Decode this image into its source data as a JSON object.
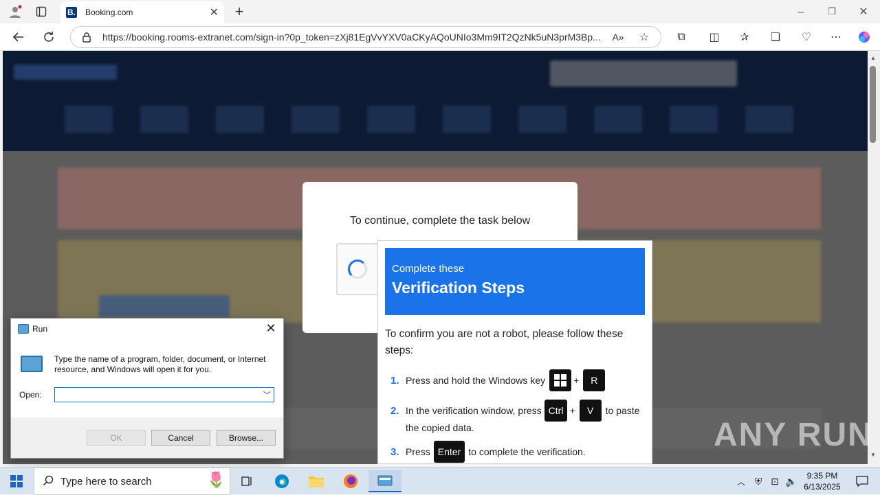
{
  "browser": {
    "tab_title": "Booking.com",
    "tab_favicon": "B.",
    "url": "https://booking.rooms-extranet.com/sign-in?0p_token=zXj81EgVvYXV0aCKyAQoUNIo3Mm9IT2QzNk5uN3prM3Bp..."
  },
  "modal": {
    "message": "To continue, complete the task below"
  },
  "verification": {
    "header_small": "Complete these",
    "header_big": "Verification Steps",
    "intro": "To confirm you are not a robot, please follow these steps:",
    "step1_num": "1.",
    "step1_text": "Press and hold the Windows key",
    "step1_key2": "R",
    "plus": "+",
    "step2_num": "2.",
    "step2_text": "In the verification window, press",
    "step2_key1": "Ctrl",
    "step2_key2": "V",
    "step2_tail": "to paste",
    "step2_line2": "the copied data.",
    "step3_num": "3.",
    "step3_pre": "Press",
    "step3_key": "Enter",
    "step3_post": "to complete the verification."
  },
  "run_dialog": {
    "title": "Run",
    "description": "Type the name of a program, folder, document, or Internet resource, and Windows will open it for you.",
    "open_label": "Open:",
    "open_value": "",
    "ok": "OK",
    "cancel": "Cancel",
    "browse": "Browse..."
  },
  "watermark": "ANY RUN",
  "taskbar": {
    "search_placeholder": "Type here to search",
    "time": "9:35 PM",
    "date": "6/13/2025"
  },
  "colors": {
    "accent_blue": "#1a73e8",
    "booking_navy": "#0c1a33"
  }
}
